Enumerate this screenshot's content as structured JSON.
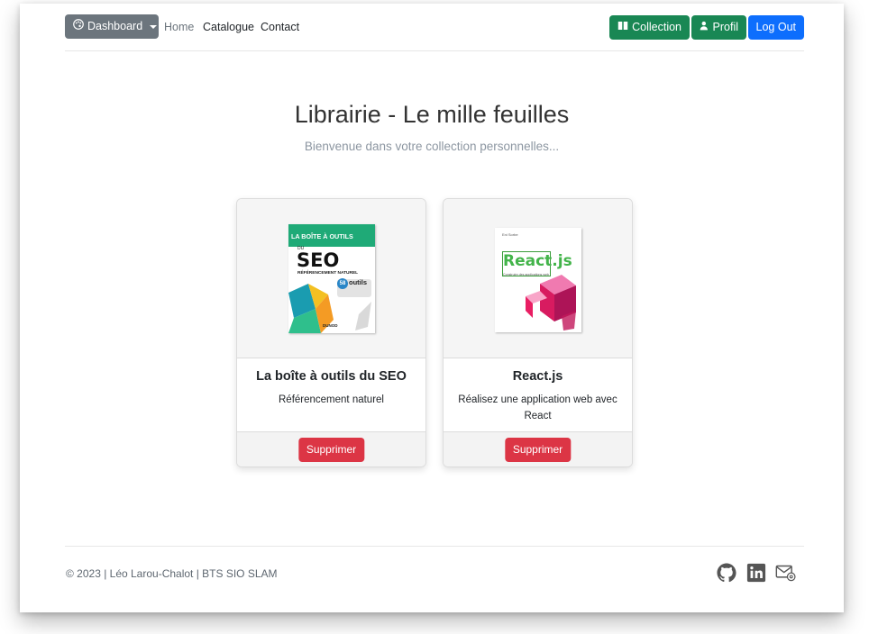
{
  "navbar": {
    "dashboard_label": "Dashboard",
    "links": [
      "Home",
      "Catalogue",
      "Contact"
    ],
    "collection_label": "Collection",
    "profile_label": "Profil",
    "logout_label": "Log Out"
  },
  "hero": {
    "title": "Librairie - Le mille feuilles",
    "subtitle": "Bienvenue dans votre collection personnelles..."
  },
  "books": [
    {
      "title": "La boîte à outils du SEO",
      "subtitle": "Référencement naturel",
      "delete_label": "Supprimer",
      "cover": {
        "band": "LA BOÎTE À OUTILS",
        "du": "DU",
        "big": "SEO",
        "ref": "RÉFÉRENCEMENT NATUREL",
        "num": "58",
        "outils": "outils",
        "publisher": "DUNOD"
      }
    },
    {
      "title": "React.js",
      "subtitle": "Réalisez une application web avec React",
      "delete_label": "Supprimer",
      "cover": {
        "top": "Eni Sorbe",
        "word": "React.js",
        "sub": "Construire des applications web"
      }
    }
  ],
  "footer": {
    "copyright": "© 2023 | Léo Larou-Chalot | BTS SIO SLAM",
    "icons": [
      "github-icon",
      "linkedin-icon",
      "email-icon"
    ]
  },
  "colors": {
    "success": "#198754",
    "primary": "#0d6efd",
    "secondary": "#6c757d",
    "danger": "#dc3545"
  }
}
